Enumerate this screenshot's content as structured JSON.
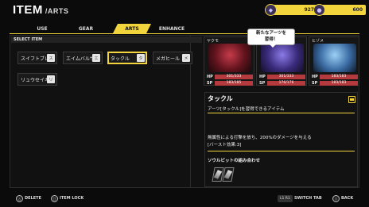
{
  "header": {
    "title": "ITEM",
    "subtitle": "/ARTS"
  },
  "currency": [
    {
      "value": "927",
      "icon": "soul-gem-icon"
    },
    {
      "value": "600",
      "icon": "coin-icon"
    }
  ],
  "tabs": [
    {
      "label": "USE",
      "active": false
    },
    {
      "label": "GEAR",
      "active": false
    },
    {
      "label": "ARTS",
      "active": true
    },
    {
      "label": "ENHANCE",
      "active": false
    }
  ],
  "list": {
    "section_label": "SELECT ITEM",
    "items": [
      {
        "label": "スイフトブレ",
        "badge": "ス"
      },
      {
        "label": "エイムバルサ",
        "badge": "エ"
      },
      {
        "label": "タックル",
        "badge": "タ",
        "selected": true
      },
      {
        "label": "メガヒール",
        "badge": "メ"
      },
      {
        "label": "リュウセイキ",
        "badge": "リ"
      }
    ]
  },
  "party": [
    {
      "name": "ヤクモ",
      "hp": "301/333",
      "sp": "183/185"
    },
    {
      "name": "",
      "hp": "301/333",
      "sp": "176/176"
    },
    {
      "name": "ヒゾメ",
      "hp": "183/183",
      "sp": "183/183"
    }
  ],
  "bubble": {
    "line1": "新たなアーツを",
    "line2": "習得！"
  },
  "detail": {
    "title": "タックル",
    "description": "アーツ[タックル]を習得できるアイテム",
    "effect_line1": "無属性による打撃を放ち、200%のダメージを与える",
    "effect_line2": "[バースト効果:3]",
    "combo_label": "ソウルビットの組み合わせ"
  },
  "footer": {
    "delete": "DELETE",
    "item_lock": "ITEM LOCK",
    "switch_key": "L1 R1",
    "switch_tab": "SWITCH TAB",
    "back": "BACK"
  },
  "colors": {
    "accent": "#f2d53c",
    "stat_bar": "#b53a3e"
  }
}
